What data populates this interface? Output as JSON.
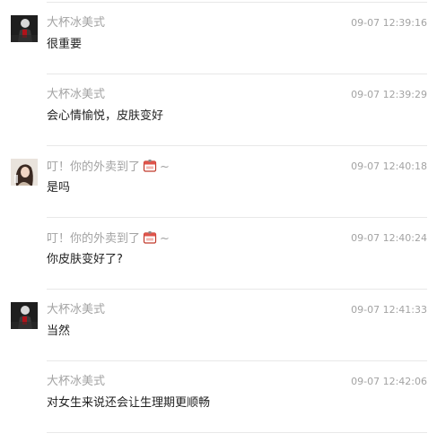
{
  "messages": [
    {
      "sender": "大杯冰美式",
      "time": "09-07 12:39:16",
      "text": "很重要",
      "avatar": "dark-figure-avatar"
    },
    {
      "sender": "大杯冰美式",
      "time": "09-07 12:39:29",
      "text": "会心情愉悦，皮肤变好",
      "avatar": ""
    },
    {
      "sender": "叮！你的外卖到了",
      "sender_suffix": "~",
      "time": "09-07 12:40:18",
      "text": "是吗",
      "avatar": "girl-photo-avatar",
      "emoji": "takeout-box-icon"
    },
    {
      "sender": "叮！你的外卖到了",
      "sender_suffix": "~",
      "time": "09-07 12:40:24",
      "text": "你皮肤变好了?",
      "avatar": "",
      "emoji": "takeout-box-icon"
    },
    {
      "sender": "大杯冰美式",
      "time": "09-07 12:41:33",
      "text": "当然",
      "avatar": "dark-figure-avatar"
    },
    {
      "sender": "大杯冰美式",
      "time": "09-07 12:42:06",
      "text": "对女生来说还会让生理期更顺畅",
      "avatar": ""
    }
  ]
}
